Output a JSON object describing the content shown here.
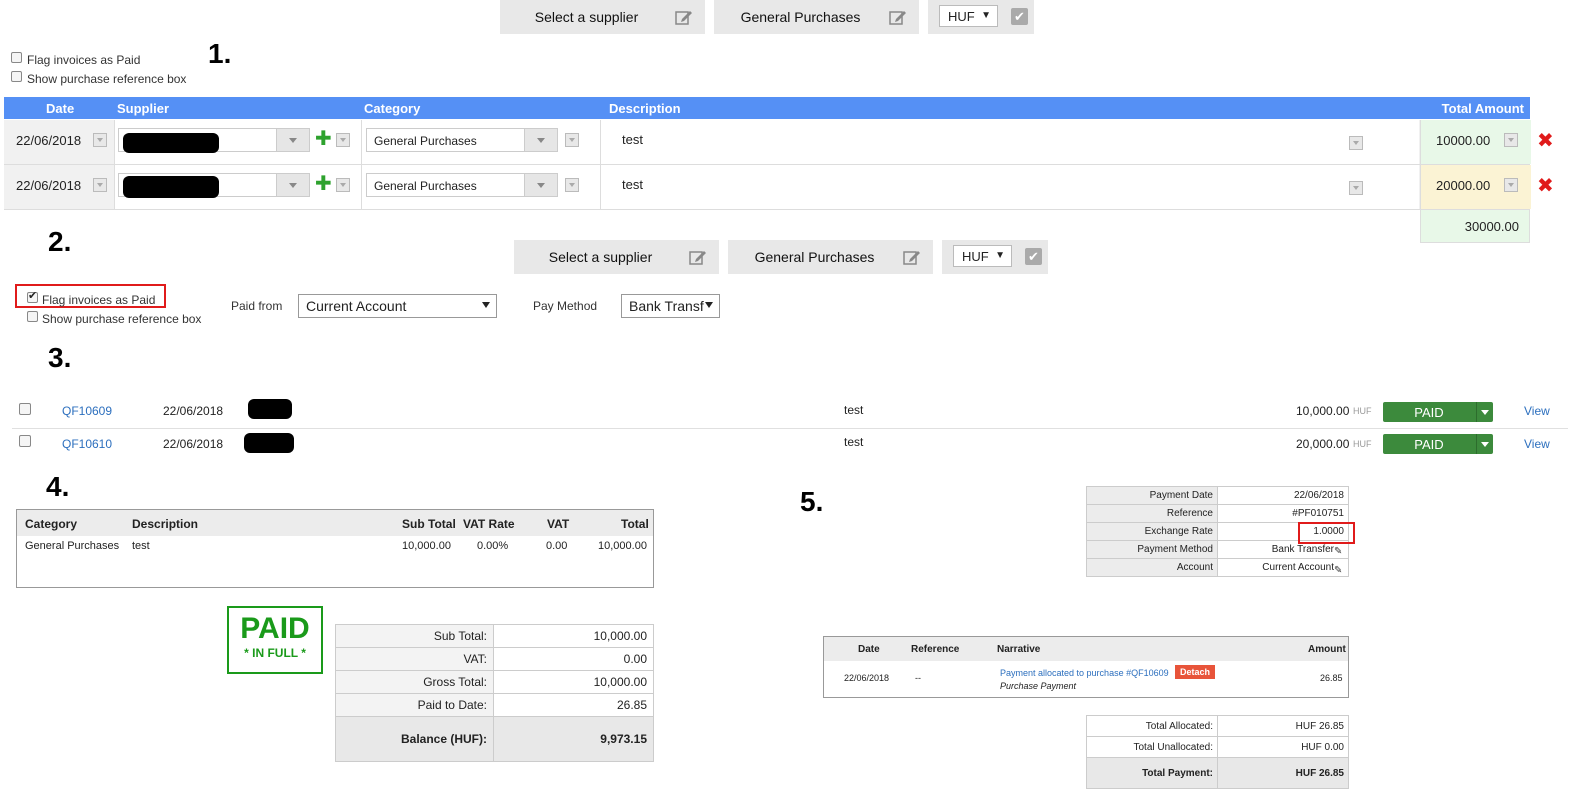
{
  "section1": {
    "step_label": "1.",
    "supplier_btn": "Select a supplier",
    "category_btn": "General Purchases",
    "currency": "HUF",
    "flag_paid": "Flag invoices as Paid",
    "show_ref": "Show purchase reference box"
  },
  "grid": {
    "headers": {
      "date": "Date",
      "supplier": "Supplier",
      "category": "Category",
      "description": "Description",
      "total": "Total Amount"
    },
    "rows": [
      {
        "date": "22/06/2018",
        "category": "General Purchases",
        "description": "test",
        "amount": "10000.00"
      },
      {
        "date": "22/06/2018",
        "category": "General Purchases",
        "description": "test",
        "amount": "20000.00"
      }
    ],
    "grand_total": "30000.00"
  },
  "section2": {
    "step_label": "2.",
    "supplier_btn": "Select a supplier",
    "category_btn": "General Purchases",
    "currency": "HUF",
    "flag_paid": "Flag invoices as Paid",
    "show_ref": "Show purchase reference box",
    "paid_from_label": "Paid from",
    "paid_from_value": "Current Account",
    "pay_method_label": "Pay Method",
    "pay_method_value": "Bank Transf"
  },
  "section3": {
    "step_label": "3.",
    "rows": [
      {
        "ref": "QF10609",
        "date": "22/06/2018",
        "description": "test",
        "amount": "10,000.00",
        "currency": "HUF",
        "status": "PAID",
        "view": "View"
      },
      {
        "ref": "QF10610",
        "date": "22/06/2018",
        "description": "test",
        "amount": "20,000.00",
        "currency": "HUF",
        "status": "PAID",
        "view": "View"
      }
    ]
  },
  "section4": {
    "step_label": "4.",
    "headers": {
      "category": "Category",
      "description": "Description",
      "sub_total": "Sub Total",
      "vat_rate": "VAT Rate",
      "vat": "VAT",
      "total": "Total"
    },
    "line": {
      "category": "General Purchases",
      "description": "test",
      "sub_total": "10,000.00",
      "vat_rate": "0.00%",
      "vat": "0.00",
      "total": "10,000.00"
    },
    "stamp_main": "PAID",
    "stamp_sub": "* IN FULL *",
    "summary": [
      {
        "label": "Sub Total:",
        "value": "10,000.00"
      },
      {
        "label": "VAT:",
        "value": "0.00"
      },
      {
        "label": "Gross Total:",
        "value": "10,000.00"
      },
      {
        "label": "Paid to Date:",
        "value": "26.85"
      },
      {
        "label": "Balance (HUF):",
        "value": "9,973.15"
      }
    ]
  },
  "section5": {
    "step_label": "5.",
    "payment_info": [
      {
        "label": "Payment Date",
        "value": "22/06/2018"
      },
      {
        "label": "Reference",
        "value": "#PF010751"
      },
      {
        "label": "Exchange Rate",
        "value": "1.0000"
      },
      {
        "label": "Payment Method",
        "value": "Bank Transfer"
      },
      {
        "label": "Account",
        "value": "Current Account"
      }
    ],
    "alloc_headers": {
      "date": "Date",
      "reference": "Reference",
      "narrative": "Narrative",
      "amount": "Amount"
    },
    "alloc_row": {
      "date": "22/06/2018",
      "reference": "--",
      "narrative": "Payment allocated to purchase #QF10609",
      "detach": "Detach",
      "sub": "Purchase Payment",
      "amount": "26.85"
    },
    "totals": [
      {
        "label": "Total Allocated:",
        "value": "HUF 26.85"
      },
      {
        "label": "Total Unallocated:",
        "value": "HUF 0.00"
      },
      {
        "label": "Total Payment:",
        "value": "HUF 26.85"
      }
    ]
  },
  "colors": {
    "header_blue": "#5590f5",
    "paid_green": "#3c8a3c",
    "highlight_red": "#e01b1b",
    "stamp_green": "#1a9a1a"
  }
}
